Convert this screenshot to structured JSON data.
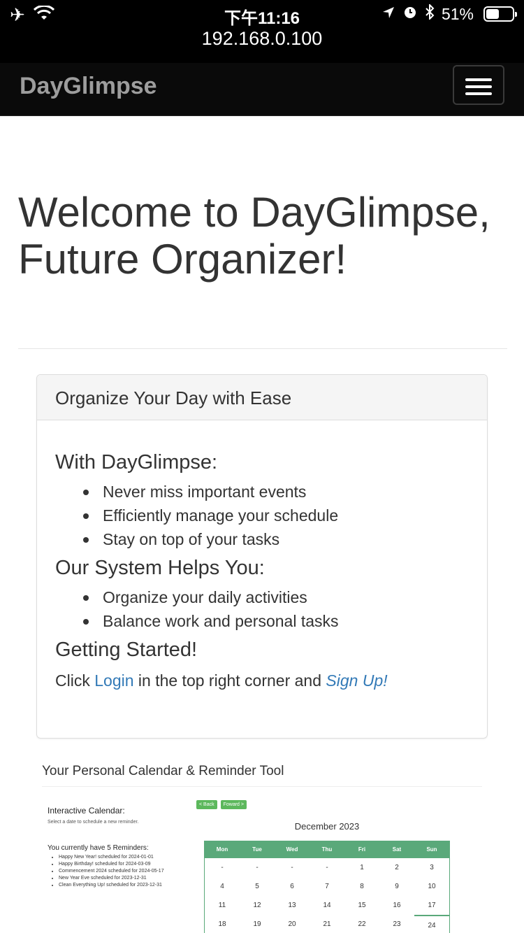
{
  "status_bar": {
    "time": "下午11:16",
    "battery": "51%",
    "battery_level": 0.51,
    "url": "192.168.0.100",
    "icons": [
      "airplane-icon",
      "wifi-icon",
      "location-icon",
      "alarm-icon",
      "bluetooth-icon",
      "battery-icon"
    ]
  },
  "navbar": {
    "brand": "DayGlimpse",
    "menu_icon": "hamburger-icon",
    "bg_color": "#0a0a0a",
    "brand_color": "#9d9d9d"
  },
  "hero": {
    "title": "Welcome to DayGlimpse, Future Organizer!"
  },
  "panel": {
    "heading": "Organize Your Day with Ease",
    "section1": {
      "title": "With DayGlimpse:",
      "items": [
        "Never miss important events",
        "Efficiently manage your schedule",
        "Stay on top of your tasks"
      ]
    },
    "section2": {
      "title": "Our System Helps You:",
      "items": [
        "Organize your daily activities",
        "Balance work and personal tasks"
      ]
    },
    "section3": {
      "title": "Getting Started!",
      "text_before": "Click ",
      "login_link": "Login",
      "text_middle": " in the top right corner and ",
      "signup_link": "Sign Up!"
    },
    "link_color": "#337ab7"
  },
  "preview": {
    "title": "Your Personal Calendar & Reminder Tool",
    "calendar_heading": "Interactive Calendar:",
    "calendar_sub": "Select a date to schedule a new reminder.",
    "reminders_heading": "You currently have 5 Reminders:",
    "reminders": [
      "Happy New Year! scheduled for 2024-01-01",
      "Happy Birthday! scheduled for 2024-03-09",
      "Commencement 2024 scheduled for 2024-05-17",
      "New Year Eve scheduled for 2023-12-31",
      "Clean Everything Up! scheduled for 2023-12-31"
    ],
    "back_button": "< Back",
    "forward_button": "Foward >",
    "month": "December 2023",
    "weekdays": [
      "Mon",
      "Tue",
      "Wed",
      "Thu",
      "Fri",
      "Sat",
      "Sun"
    ],
    "weeks": [
      [
        "-",
        "-",
        "-",
        "-",
        "1",
        "2",
        "3"
      ],
      [
        "4",
        "5",
        "6",
        "7",
        "8",
        "9",
        "10"
      ],
      [
        "11",
        "12",
        "13",
        "14",
        "15",
        "16",
        "17"
      ],
      [
        "18",
        "19",
        "20",
        "21",
        "22",
        "23",
        "24"
      ]
    ],
    "accent_color": "#5aa97a"
  }
}
